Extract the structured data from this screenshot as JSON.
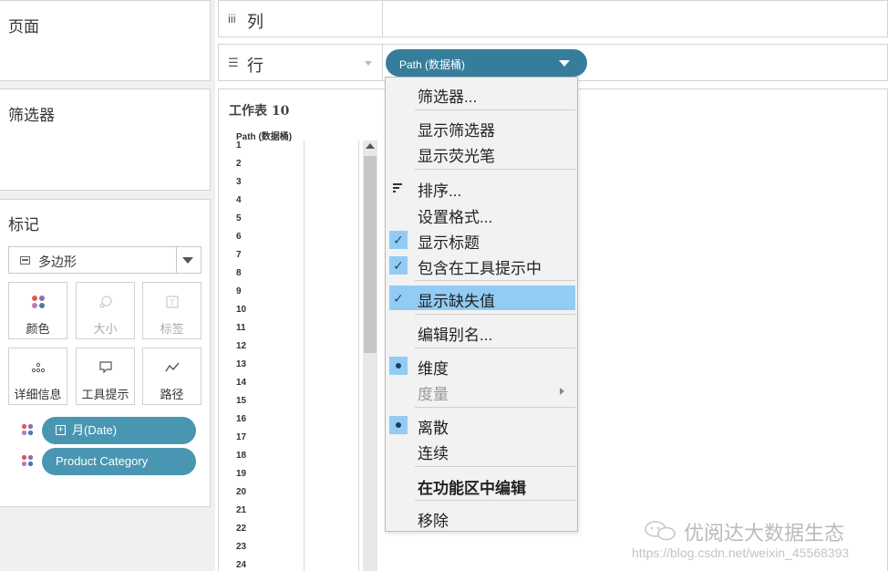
{
  "left": {
    "pages_title": "页面",
    "filters_title": "筛选器",
    "marks_title": "标记",
    "mark_type": "多边形",
    "mark_buttons": [
      {
        "label": "颜色",
        "icon": "color-dots-icon"
      },
      {
        "label": "大小",
        "icon": "size-icon"
      },
      {
        "label": "标签",
        "icon": "text-label-icon"
      },
      {
        "label": "详细信息",
        "icon": "detail-dots-icon"
      },
      {
        "label": "工具提示",
        "icon": "tooltip-icon"
      },
      {
        "label": "路径",
        "icon": "path-line-icon"
      }
    ],
    "pills": [
      {
        "label": "月(Date)",
        "icon": "expand-plus-icon"
      },
      {
        "label": "Product Category"
      }
    ]
  },
  "shelves": {
    "columns_label": "列",
    "rows_label": "行",
    "rows_pill": "Path (数据桶)"
  },
  "sheet": {
    "title": "工作表 10",
    "column_header": "Path (数据桶)",
    "row_numbers": [
      "1",
      "2",
      "3",
      "4",
      "5",
      "6",
      "7",
      "8",
      "9",
      "10",
      "11",
      "12",
      "13",
      "14",
      "15",
      "16",
      "17",
      "18",
      "19",
      "20",
      "21",
      "22",
      "23",
      "24"
    ]
  },
  "menu": {
    "filter": "筛选器...",
    "show_filter": "显示筛选器",
    "show_highlighter": "显示荧光笔",
    "sort": "排序...",
    "format": "设置格式...",
    "show_header": "显示标题",
    "include_in_tooltip": "包含在工具提示中",
    "show_missing_values": "显示缺失值",
    "edit_alias": "编辑别名...",
    "dimension": "维度",
    "measure": "度量",
    "discrete": "离散",
    "continuous": "连续",
    "edit_in_shelf": "在功能区中编辑",
    "remove": "移除"
  },
  "watermark": {
    "brand": "优阅达大数据生态",
    "url": "https://blog.csdn.net/weixin_45568393"
  },
  "colors": {
    "pill": "#4996b2",
    "pill_active": "#367d9c",
    "menu_highlight": "#92cbf3"
  }
}
